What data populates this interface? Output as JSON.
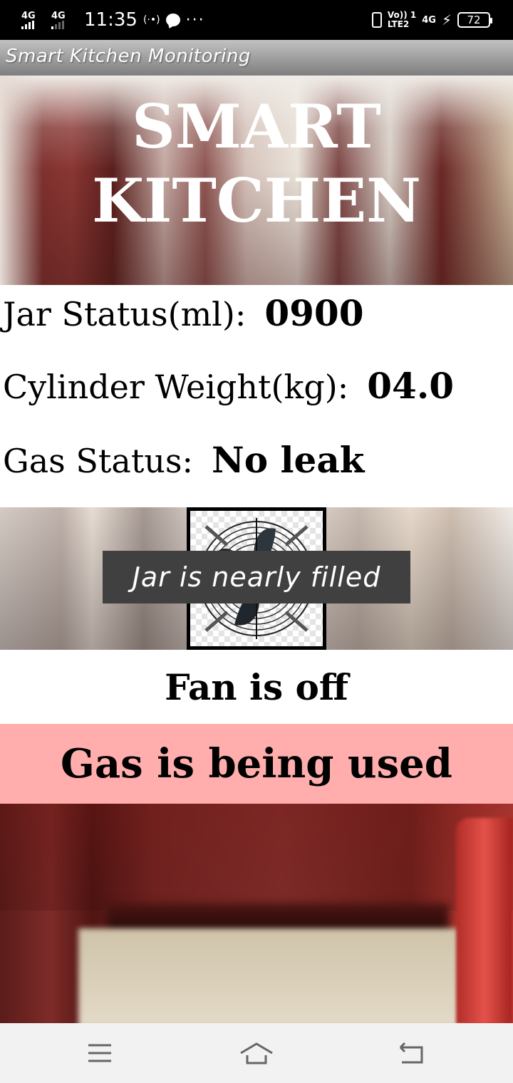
{
  "status_bar": {
    "network_1": "4G",
    "network_2": "4G",
    "time": "11:35",
    "hotspot": "(·•)",
    "more": "···",
    "volte_top": "Vo)) 1",
    "volte_bottom": "LTE2",
    "network_3": "4G",
    "battery": "72"
  },
  "app_bar": {
    "title": "Smart Kitchen Monitoring"
  },
  "banner": {
    "line1": "SMART",
    "line2": "KITCHEN"
  },
  "readings": {
    "jar_label": "Jar Status(ml):",
    "jar_value": "0900",
    "cylinder_label": "Cylinder Weight(kg):",
    "cylinder_value": "04.0",
    "gas_label": "Gas Status:",
    "gas_value": "No leak"
  },
  "toast": {
    "message": "Jar is nearly filled"
  },
  "fan_status": "Fan is off",
  "gas_usage": {
    "text": "Gas is being used",
    "color": "#ffadad"
  },
  "nav_bar": {
    "icons": [
      "menu-icon",
      "home-icon",
      "back-icon"
    ]
  }
}
